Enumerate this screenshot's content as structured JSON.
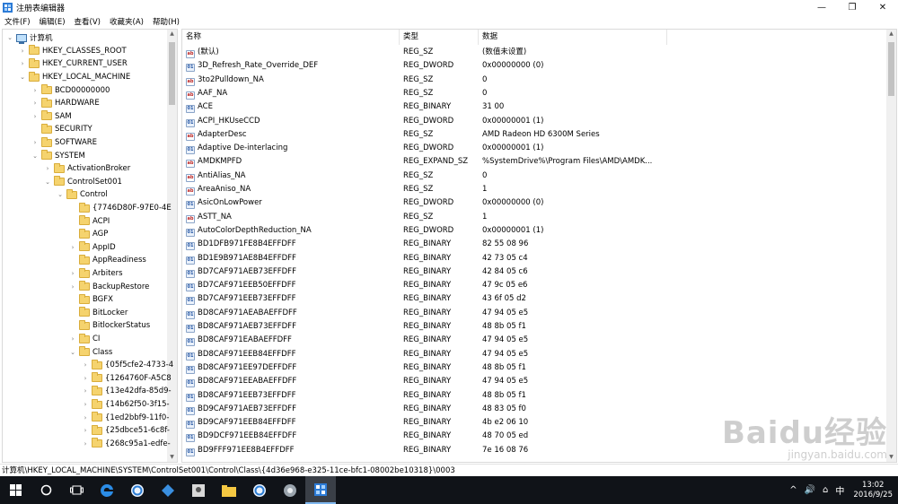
{
  "window": {
    "title": "注册表编辑器",
    "controls": {
      "minimize": "—",
      "maximize": "❐",
      "close": "✕"
    }
  },
  "menu": [
    "文件(F)",
    "编辑(E)",
    "查看(V)",
    "收藏夹(A)",
    "帮助(H)"
  ],
  "tree": [
    {
      "label": "计算机",
      "depth": 0,
      "expander": "expanded",
      "icon": "computer"
    },
    {
      "label": "HKEY_CLASSES_ROOT",
      "depth": 1,
      "expander": "collapsed",
      "icon": "folder"
    },
    {
      "label": "HKEY_CURRENT_USER",
      "depth": 1,
      "expander": "collapsed",
      "icon": "folder"
    },
    {
      "label": "HKEY_LOCAL_MACHINE",
      "depth": 1,
      "expander": "expanded",
      "icon": "folder"
    },
    {
      "label": "BCD00000000",
      "depth": 2,
      "expander": "collapsed",
      "icon": "folder"
    },
    {
      "label": "HARDWARE",
      "depth": 2,
      "expander": "collapsed",
      "icon": "folder"
    },
    {
      "label": "SAM",
      "depth": 2,
      "expander": "collapsed",
      "icon": "folder"
    },
    {
      "label": "SECURITY",
      "depth": 2,
      "expander": "none",
      "icon": "folder"
    },
    {
      "label": "SOFTWARE",
      "depth": 2,
      "expander": "collapsed",
      "icon": "folder"
    },
    {
      "label": "SYSTEM",
      "depth": 2,
      "expander": "expanded",
      "icon": "folder"
    },
    {
      "label": "ActivationBroker",
      "depth": 3,
      "expander": "collapsed",
      "icon": "folder"
    },
    {
      "label": "ControlSet001",
      "depth": 3,
      "expander": "expanded",
      "icon": "folder"
    },
    {
      "label": "Control",
      "depth": 4,
      "expander": "expanded",
      "icon": "folder"
    },
    {
      "label": "{7746D80F-97E0-4E",
      "depth": 5,
      "expander": "none",
      "icon": "folder"
    },
    {
      "label": "ACPI",
      "depth": 5,
      "expander": "none",
      "icon": "folder"
    },
    {
      "label": "AGP",
      "depth": 5,
      "expander": "none",
      "icon": "folder"
    },
    {
      "label": "AppID",
      "depth": 5,
      "expander": "collapsed",
      "icon": "folder"
    },
    {
      "label": "AppReadiness",
      "depth": 5,
      "expander": "none",
      "icon": "folder"
    },
    {
      "label": "Arbiters",
      "depth": 5,
      "expander": "collapsed",
      "icon": "folder"
    },
    {
      "label": "BackupRestore",
      "depth": 5,
      "expander": "collapsed",
      "icon": "folder"
    },
    {
      "label": "BGFX",
      "depth": 5,
      "expander": "none",
      "icon": "folder"
    },
    {
      "label": "BitLocker",
      "depth": 5,
      "expander": "none",
      "icon": "folder"
    },
    {
      "label": "BitlockerStatus",
      "depth": 5,
      "expander": "none",
      "icon": "folder"
    },
    {
      "label": "CI",
      "depth": 5,
      "expander": "collapsed",
      "icon": "folder"
    },
    {
      "label": "Class",
      "depth": 5,
      "expander": "expanded",
      "icon": "folder"
    },
    {
      "label": "{05f5cfe2-4733-4",
      "depth": 6,
      "expander": "collapsed",
      "icon": "folder"
    },
    {
      "label": "{1264760F-A5C8",
      "depth": 6,
      "expander": "collapsed",
      "icon": "folder"
    },
    {
      "label": "{13e42dfa-85d9-",
      "depth": 6,
      "expander": "collapsed",
      "icon": "folder"
    },
    {
      "label": "{14b62f50-3f15-",
      "depth": 6,
      "expander": "collapsed",
      "icon": "folder"
    },
    {
      "label": "{1ed2bbf9-11f0-",
      "depth": 6,
      "expander": "collapsed",
      "icon": "folder"
    },
    {
      "label": "{25dbce51-6c8f-",
      "depth": 6,
      "expander": "collapsed",
      "icon": "folder"
    },
    {
      "label": "{268c95a1-edfe-",
      "depth": 6,
      "expander": "collapsed",
      "icon": "folder"
    }
  ],
  "columns": {
    "name": "名称",
    "type": "类型",
    "data": "数据"
  },
  "values": [
    {
      "name": "(默认)",
      "type": "REG_SZ",
      "data": "(数值未设置)",
      "icon": "string"
    },
    {
      "name": "3D_Refresh_Rate_Override_DEF",
      "type": "REG_DWORD",
      "data": "0x00000000 (0)",
      "icon": "binary"
    },
    {
      "name": "3to2Pulldown_NA",
      "type": "REG_SZ",
      "data": "0",
      "icon": "string"
    },
    {
      "name": "AAF_NA",
      "type": "REG_SZ",
      "data": "0",
      "icon": "string"
    },
    {
      "name": "ACE",
      "type": "REG_BINARY",
      "data": "31 00",
      "icon": "binary"
    },
    {
      "name": "ACPI_HKUseCCD",
      "type": "REG_DWORD",
      "data": "0x00000001 (1)",
      "icon": "binary"
    },
    {
      "name": "AdapterDesc",
      "type": "REG_SZ",
      "data": "AMD Radeon HD 6300M Series",
      "icon": "string"
    },
    {
      "name": "Adaptive De-interlacing",
      "type": "REG_DWORD",
      "data": "0x00000001 (1)",
      "icon": "binary"
    },
    {
      "name": "AMDKMPFD",
      "type": "REG_EXPAND_SZ",
      "data": "%SystemDrive%\\Program Files\\AMD\\AMDK...",
      "icon": "string"
    },
    {
      "name": "AntiAlias_NA",
      "type": "REG_SZ",
      "data": "0",
      "icon": "string"
    },
    {
      "name": "AreaAniso_NA",
      "type": "REG_SZ",
      "data": "1",
      "icon": "string"
    },
    {
      "name": "AsicOnLowPower",
      "type": "REG_DWORD",
      "data": "0x00000000 (0)",
      "icon": "binary"
    },
    {
      "name": "ASTT_NA",
      "type": "REG_SZ",
      "data": "1",
      "icon": "string"
    },
    {
      "name": "AutoColorDepthReduction_NA",
      "type": "REG_DWORD",
      "data": "0x00000001 (1)",
      "icon": "binary"
    },
    {
      "name": "BD1DFB971FE8B4EFFDFF",
      "type": "REG_BINARY",
      "data": "82 55 08 96",
      "icon": "binary"
    },
    {
      "name": "BD1E9B971AE8B4EFFDFF",
      "type": "REG_BINARY",
      "data": "42 73 05 c4",
      "icon": "binary"
    },
    {
      "name": "BD7CAF971AEB73EFFDFF",
      "type": "REG_BINARY",
      "data": "42 84 05 c6",
      "icon": "binary"
    },
    {
      "name": "BD7CAF971EEB50EFFDFF",
      "type": "REG_BINARY",
      "data": "47 9c 05 e6",
      "icon": "binary"
    },
    {
      "name": "BD7CAF971EEB73EFFDFF",
      "type": "REG_BINARY",
      "data": "43 6f 05 d2",
      "icon": "binary"
    },
    {
      "name": "BD8CAF971AEABAEFFDFF",
      "type": "REG_BINARY",
      "data": "47 94 05 e5",
      "icon": "binary"
    },
    {
      "name": "BD8CAF971AEB73EFFDFF",
      "type": "REG_BINARY",
      "data": "48 8b 05 f1",
      "icon": "binary"
    },
    {
      "name": "BD8CAF971EABAEFFDFF",
      "type": "REG_BINARY",
      "data": "47 94 05 e5",
      "icon": "binary"
    },
    {
      "name": "BD8CAF971EEB84EFFDFF",
      "type": "REG_BINARY",
      "data": "47 94 05 e5",
      "icon": "binary"
    },
    {
      "name": "BD8CAF971EE97DEFFDFF",
      "type": "REG_BINARY",
      "data": "48 8b 05 f1",
      "icon": "binary"
    },
    {
      "name": "BD8CAF971EEABAEFFDFF",
      "type": "REG_BINARY",
      "data": "47 94 05 e5",
      "icon": "binary"
    },
    {
      "name": "BD8CAF971EEB73EFFDFF",
      "type": "REG_BINARY",
      "data": "48 8b 05 f1",
      "icon": "binary"
    },
    {
      "name": "BD9CAF971AEB73EFFDFF",
      "type": "REG_BINARY",
      "data": "48 83 05 f0",
      "icon": "binary"
    },
    {
      "name": "BD9CAF971EEB84EFFDFF",
      "type": "REG_BINARY",
      "data": "4b e2 06 10",
      "icon": "binary"
    },
    {
      "name": "BD9DCF971EEB84EFFDFF",
      "type": "REG_BINARY",
      "data": "48 70 05 ed",
      "icon": "binary"
    },
    {
      "name": "BD9FFF971EE8B4EFFDFF",
      "type": "REG_BINARY",
      "data": "7e 16 08 76",
      "icon": "binary"
    }
  ],
  "statusbar": "计算机\\HKEY_LOCAL_MACHINE\\SYSTEM\\ControlSet001\\Control\\Class\\{4d36e968-e325-11ce-bfc1-08002be10318}\\0003",
  "taskbar": {
    "apps": [
      "start-icon",
      "search-icon",
      "task-view-icon",
      "edge-icon",
      "browser-icon",
      "app-icon",
      "app-icon",
      "explorer-icon",
      "browser-icon",
      "app-icon",
      "regedit-icon"
    ],
    "tray": {
      "expand": "^",
      "volume": "🔊",
      "network": "⌂",
      "ime": "中"
    },
    "time": "13:02",
    "date": "2016/9/25"
  },
  "watermark": {
    "brand": "Baidu经验",
    "site": "jingyan.baidu.com"
  },
  "colors": {
    "taskbar": "#101318",
    "folder": "#f5d36e",
    "accent": "#7fb7ee"
  }
}
